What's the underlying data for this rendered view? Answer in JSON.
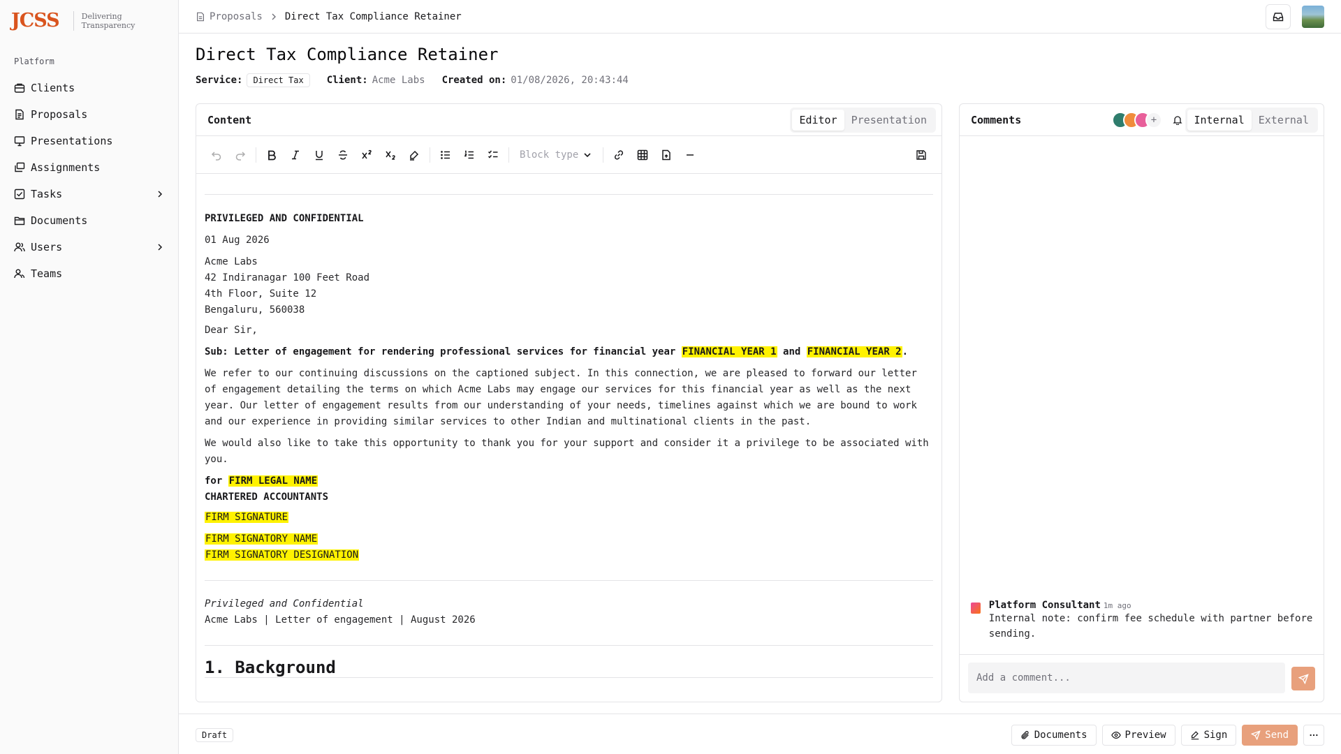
{
  "brand": {
    "logo": "JCSS",
    "tagline_line1": "Delivering",
    "tagline_line2": "Transparency",
    "accent": "#d9541e"
  },
  "sidebar": {
    "section_label": "Platform",
    "items": [
      {
        "label": "Clients",
        "icon": "building-icon"
      },
      {
        "label": "Proposals",
        "icon": "file-text-icon"
      },
      {
        "label": "Presentations",
        "icon": "presentation-icon"
      },
      {
        "label": "Assignments",
        "icon": "layers-icon"
      },
      {
        "label": "Tasks",
        "icon": "check-square-icon",
        "expandable": true
      },
      {
        "label": "Documents",
        "icon": "folder-icon"
      },
      {
        "label": "Users",
        "icon": "users-icon",
        "expandable": true
      },
      {
        "label": "Teams",
        "icon": "user-group-icon"
      }
    ]
  },
  "breadcrumb": {
    "parent": "Proposals",
    "current": "Direct Tax Compliance Retainer"
  },
  "page": {
    "title": "Direct Tax Compliance Retainer",
    "service_label": "Service:",
    "service_value": "Direct Tax",
    "client_label": "Client:",
    "client_value": "Acme Labs",
    "created_label": "Created on:",
    "created_value": "01/08/2026, 20:43:44"
  },
  "editor": {
    "title": "Content",
    "modes": [
      "Editor",
      "Presentation"
    ],
    "active_mode": "Editor",
    "block_type_placeholder": "Block type"
  },
  "document": {
    "heading": "PRIVILEGED AND CONFIDENTIAL",
    "date": "01 Aug 2026",
    "address": [
      "Acme Labs",
      "42 Indiranagar 100 Feet Road",
      "4th Floor, Suite 12",
      "Bengaluru, 560038"
    ],
    "salutation": "Dear Sir,",
    "subject_prefix": "Sub: Letter of engagement for rendering professional services for financial year ",
    "subject_var1": "FINANCIAL YEAR 1",
    "subject_and": " and ",
    "subject_var2": "FINANCIAL YEAR 2",
    "subject_end": ".",
    "para1": "We refer to our continuing discussions on the captioned subject. In this connection, we are pleased to forward our letter of engagement detailing the terms on which Acme Labs may engage our services for this financial year as well as the next year. Our letter of engagement results from our understanding of your needs, timelines against which we are bound to work and our experience in providing similar services to other Indian and multinational clients in the past.",
    "para2": "We would also like to take this opportunity to thank you for your support and consider it a privilege to be associated with you.",
    "for_prefix": "for ",
    "firm_name": "FIRM LEGAL NAME",
    "ca_line": "CHARTERED ACCOUNTANTS",
    "firm_signature": "FIRM SIGNATURE",
    "signatory_name": "FIRM SIGNATORY NAME",
    "signatory_designation": "FIRM SIGNATORY DESIGNATION",
    "footer_italic": "Privileged and Confidential",
    "footer_line": "Acme Labs | Letter of engagement | August 2026",
    "section_heading": "1. Background",
    "highlight_color": "#fff200"
  },
  "comments": {
    "title": "Comments",
    "add_participant": "+",
    "tabs": [
      "Internal",
      "External"
    ],
    "active_tab": "Internal",
    "participant_colors": [
      "#2f7d6d",
      "#f08c3c",
      "#e85f9a"
    ],
    "entries": [
      {
        "author": "Platform Consultant",
        "time": "1m ago",
        "text": "Internal note: confirm fee schedule with partner before sending."
      }
    ],
    "input_placeholder": "Add a comment..."
  },
  "footer": {
    "status": "Draft",
    "actions": {
      "documents": "Documents",
      "preview": "Preview",
      "sign": "Sign",
      "send": "Send"
    },
    "send_color": "#e8a07c"
  }
}
